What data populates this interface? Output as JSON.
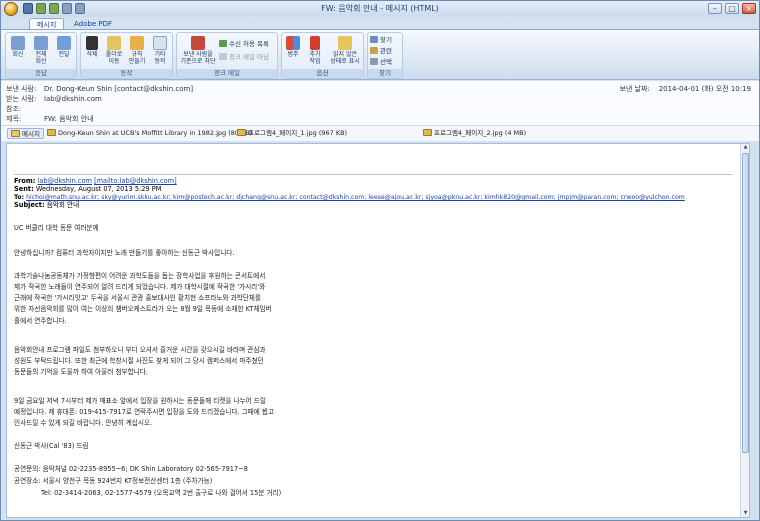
{
  "window": {
    "title": "FW: 음악회 안내 - 메시지 (HTML)",
    "controls": [
      "–",
      "□",
      "×"
    ]
  },
  "tabs": [
    {
      "label": "메시지",
      "active": true
    },
    {
      "label": "Adobe PDF",
      "active": false
    }
  ],
  "ribbon": {
    "groups": [
      {
        "label": "응답",
        "buttons": [
          "회신",
          "전체\n회신",
          "전달"
        ]
      },
      {
        "label": "동작",
        "buttons": [
          "삭제",
          "폴더로\n이동",
          "규칙\n만들기",
          "기타\n동작"
        ]
      },
      {
        "label": "정크 메일",
        "buttons": [
          "보낸 사람을\n기준으로 차단"
        ],
        "small": [
          "수신 허용 목록",
          "정크 메일 아님"
        ]
      },
      {
        "label": "옵션",
        "buttons": [
          "범주",
          "추가\n작업",
          "읽지 않은\n상태로 표시"
        ]
      },
      {
        "label": "찾기",
        "small": [
          "찾기",
          "관련",
          "선택"
        ]
      }
    ]
  },
  "header": {
    "from_label": "보낸 사람:",
    "from_value": "Dr. Dong-Keun Shin [contact@dkshin.com]",
    "to_label": "받는 사람:",
    "to_value": "lab@dkshin.com",
    "cc_label": "참조:",
    "cc_value": "",
    "subject_label": "제목:",
    "subject_value": "FW: 음악회 안내",
    "sent_label": "보낸 날짜:",
    "sent_value": "2014-04-01 (화) 오전 10:19"
  },
  "attachments": [
    {
      "label": "메시지",
      "kind": "message"
    },
    {
      "label": "Dong-Keun Shin at UCB's Moffitt Library in 1982.jpg (80 KB)",
      "kind": "image"
    },
    {
      "label": "프로그램4_페이지_1.jpg (967 KB)",
      "kind": "image"
    },
    {
      "label": "프로그램4_페이지_2.jpg (4 MB)",
      "kind": "image"
    }
  ],
  "forward": {
    "from_label": "From:",
    "from_email": "lab@dkshin.com",
    "from_mailto": "[mailto:lab@dkshin.com]",
    "sent_label": "Sent:",
    "sent_value": "Wednesday, August 07, 2013 5:29 PM",
    "to_label": "To:",
    "to_list": "hichoi@math.snu.ac.kr; sky@yurim.skku.ac.kr; kim@postech.ac.kr; djchang@snu.ac.kr; contact@dkshin.com; leese@ajou.ac.kr; sjyoa@pknu.ac.kr; kimhk820@gmail.com; jmpjm@paran.com; crwoo@yulchon.com",
    "subject_label": "Subject:",
    "subject_value": "음악회 안내"
  },
  "body": [
    "UC 버클리 대학 동문 여러분께",
    "안녕하십니까? 컴퓨터 과학자이지만 노래 만들기를 좋아하는 신동근 박사입니다.",
    "과학기술나눔공동체가 가정형편이 어려운 과학도들을 돕는 장학사업을 후원하는 콘서트에서",
    "제가 작곡한 노래들이 연주되어 알려 드리게 되었습니다. 제가 대학시절에 작곡한 '가시리'와",
    "근래에 작곡한 '가시리잇고' 두곡을 서울시 관광 홍보대사인 황치현 소프라노와 과학단체를",
    "위한 자선음악회를 많이 여는 이상희 챔버오케스트라가 오는 8월 9일 목동에 소재한 KT체임버",
    "홀에서 연주합니다.",
    "음악회안내 프로그램 파일도 첨부하오니 부디 오셔서 즐거운 시간을 갖으시길 바라며 관심과",
    "성원도 부탁드립니다. 또한 최근에 학창시절 사진도 찾게 되어 그 당시 캠퍼스에서 마주쳤던",
    "동문들의 기억을 도울까 하여 아울러 첨부합니다.",
    "9일 금요일 저녁 7시부터 제가 매표소 앞에서 입장을 원하시는 동문들께 티켓을 나누어 드릴",
    "예정입니다. 제 휴대폰: 019-415-7917로 연락주시면 입장을 도와 드리겠습니다. 그때에 뵙고",
    "인사드릴 수 있게 되길 바랍니다. 안녕히 계십시오.",
    "신동근 박사(Cal '83) 드림",
    "공연문의: 음악처널 02-2235-8955~6; DK Shin Laboratory 02-565-7917~8",
    "공연장소: 서울시 양천구 목동 924번지 KT정보전산센터 1층 (주차가능)",
    "Tel: 02-3414-2063, 02-1577-4579 (오목교역 2번 출구로 나와 걸어서 15분 거리)"
  ]
}
